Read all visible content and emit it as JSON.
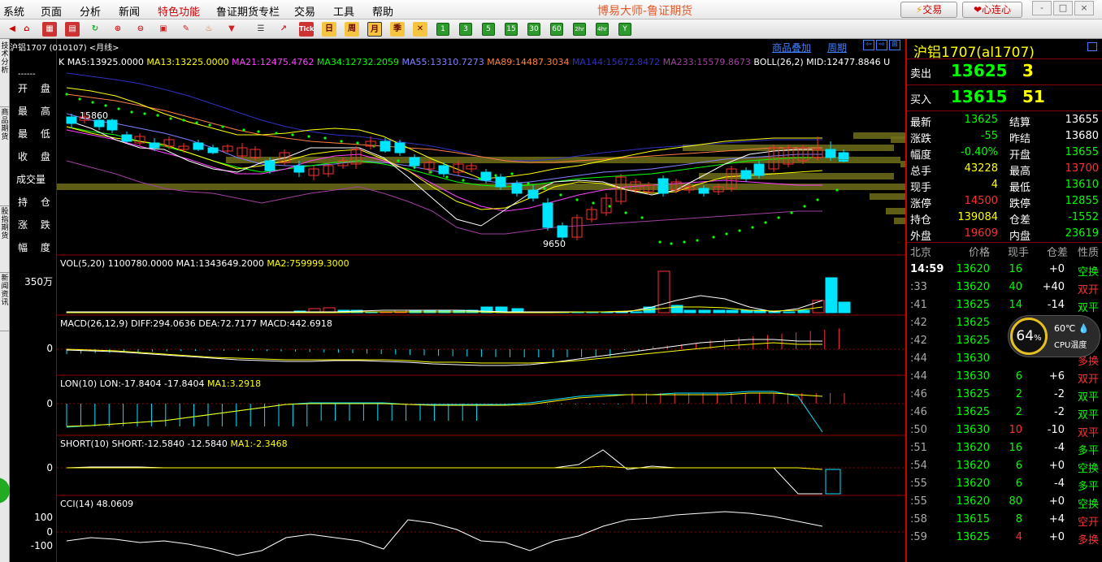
{
  "menu": [
    "系统",
    "页面",
    "分析",
    "新闻",
    "特色功能",
    "鲁证期货专栏",
    "交易",
    "工具",
    "帮助"
  ],
  "app_title": "博易大师-鲁证期货",
  "top_buttons": {
    "trade": "交易",
    "heart": "心连心"
  },
  "window_buttons": [
    "-",
    "□",
    "×"
  ],
  "toolbar_texts": {
    "tick": "Tick",
    "day": "日",
    "week": "周",
    "month": "月",
    "season": "季",
    "nums": [
      "1",
      "3",
      "5",
      "15",
      "30",
      "60",
      "2hr",
      "4hr",
      "Y"
    ]
  },
  "left_tabs": [
    "技术分析",
    "商品期货",
    "股指期货",
    "新闻资讯"
  ],
  "row_labels": [
    "开 盘",
    "最 高",
    "最 低",
    "收 盘",
    "成交量",
    "持 仓",
    "涨 跌",
    "幅 度"
  ],
  "row_dash": "------",
  "chart_header": {
    "symbol": "沪铝1707 (010107) <月线>",
    "overlay": "商品叠加",
    "period": "周期"
  },
  "ma_legend": [
    {
      "text": "K",
      "color": "#ffffff"
    },
    {
      "text": "MA5:13925.0000",
      "color": "#ffffff"
    },
    {
      "text": "MA13:13225.0000",
      "color": "#ffff00"
    },
    {
      "text": "MA21:12475.4762",
      "color": "#ff40ff"
    },
    {
      "text": "MA34:12732.2059",
      "color": "#00ff00"
    },
    {
      "text": "MA55:13310.7273",
      "color": "#8080ff"
    },
    {
      "text": "MA89:14487.3034",
      "color": "#ff8040"
    },
    {
      "text": "MA144:15672.8472",
      "color": "#3030c0"
    },
    {
      "text": "MA233:15579.8673",
      "color": "#a040a0"
    },
    {
      "text": "BOLL(26,2) MID:12477.8846 U",
      "color": "#ffffff"
    }
  ],
  "price_labels": {
    "high": "15860",
    "low": "9650"
  },
  "panels": {
    "vol": {
      "title": "VOL(5,20) 1100780.0000",
      "ma1": "MA1:1343649.2000",
      "ma2": "MA2:759999.3000",
      "axis": "350万"
    },
    "macd": {
      "title": "MACD(26,12,9) DIFF:294.0636 DEA:72.7177 MACD:442.6918",
      "axis": "0"
    },
    "lon": {
      "title": "LON(10) LON:-17.8404 -17.8404",
      "ma1": "MA1:3.2918",
      "axis": "0"
    },
    "short": {
      "title": "SHORT(10) SHORT:-12.5840 -12.5840",
      "ma1": "MA1:-2.3468",
      "axis": "0"
    },
    "cci": {
      "title": "CCI(14) 48.0609",
      "axis": [
        "100",
        "0",
        "-100"
      ]
    }
  },
  "quote": {
    "title": "沪铝1707(al1707)",
    "sell": {
      "label": "卖出",
      "price": "13625",
      "qty": "3"
    },
    "buy": {
      "label": "买入",
      "price": "13615",
      "qty": "51"
    },
    "rows": [
      [
        "最新",
        "13625",
        "结算",
        "13655"
      ],
      [
        "涨跌",
        "-55",
        "昨结",
        "13680"
      ],
      [
        "幅度",
        "-0.40%",
        "开盘",
        "13655"
      ],
      [
        "总手",
        "43228",
        "最高",
        "13700"
      ],
      [
        "现手",
        "4",
        "最低",
        "13610"
      ],
      [
        "涨停",
        "14500",
        "跌停",
        "12855"
      ],
      [
        "持仓",
        "139084",
        "仓差",
        "-1552"
      ],
      [
        "外盘",
        "19609",
        "内盘",
        "23619"
      ]
    ],
    "tick_header": [
      "北京",
      "价格",
      "现手",
      "仓差",
      "性质"
    ],
    "ticks": [
      [
        "14:59",
        "13620",
        "16",
        "+0",
        "空换"
      ],
      [
        ":33",
        "13620",
        "40",
        "+40",
        "双开"
      ],
      [
        ":41",
        "13625",
        "14",
        "-14",
        "双平"
      ],
      [
        ":42",
        "13625",
        "",
        "",
        " "
      ],
      [
        ":42",
        "13625",
        "",
        "",
        " "
      ],
      [
        ":44",
        "13630",
        "",
        "",
        "多换"
      ],
      [
        ":44",
        "13630",
        "6",
        "+6",
        "双开"
      ],
      [
        ":46",
        "13625",
        "2",
        "-2",
        "双平"
      ],
      [
        ":46",
        "13625",
        "2",
        "-2",
        "双平"
      ],
      [
        ":50",
        "13630",
        "10",
        "-10",
        "双平"
      ],
      [
        ":51",
        "13620",
        "16",
        "-4",
        "多平"
      ],
      [
        ":54",
        "13620",
        "6",
        "+0",
        "空换"
      ],
      [
        ":55",
        "13620",
        "6",
        "-4",
        "多平"
      ],
      [
        ":55",
        "13620",
        "80",
        "+0",
        "空换"
      ],
      [
        ":58",
        "13615",
        "8",
        "+4",
        "空开"
      ],
      [
        ":59",
        "13625",
        "4",
        "+0",
        "多换"
      ]
    ]
  },
  "cpu": {
    "percent": "64",
    "unit": "%",
    "temp": "60℃",
    "label": "CPU温度"
  },
  "colors": {
    "up": "#ff3030",
    "down": "#00e5ff",
    "grid": "#900000",
    "yellow": "#ffff00",
    "green": "#00ff00"
  }
}
